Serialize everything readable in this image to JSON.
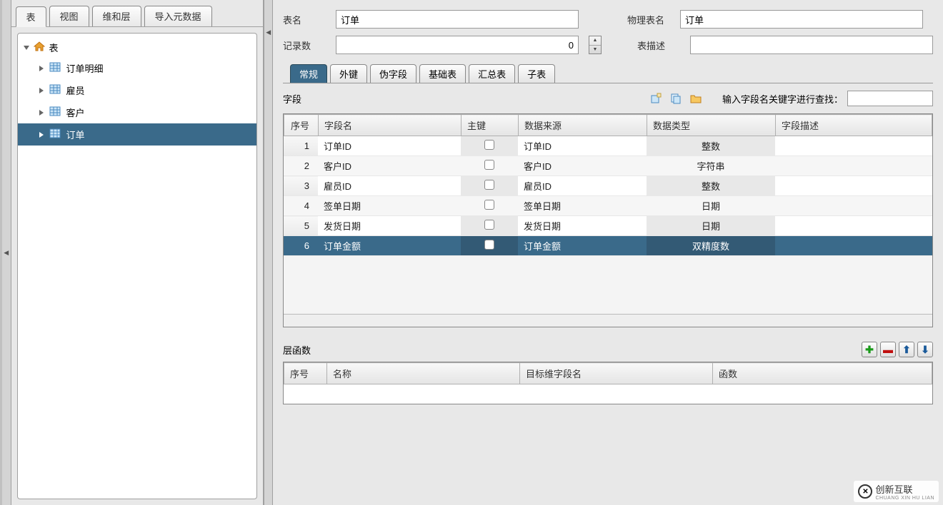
{
  "top_tabs": [
    "表",
    "视图",
    "维和层",
    "导入元数据"
  ],
  "active_top_tab": 0,
  "tree": {
    "root": "表",
    "items": [
      "订单明细",
      "雇员",
      "客户",
      "订单"
    ],
    "selected": 3
  },
  "form": {
    "table_name_label": "表名",
    "table_name_value": "订单",
    "phys_name_label": "物理表名",
    "phys_name_value": "订单",
    "record_count_label": "记录数",
    "record_count_value": "0",
    "desc_label": "表描述",
    "desc_value": ""
  },
  "sub_tabs": [
    "常规",
    "外键",
    "伪字段",
    "基础表",
    "汇总表",
    "子表"
  ],
  "active_sub_tab": 0,
  "field_section_label": "字段",
  "search_label": "输入字段名关键字进行查找：",
  "search_value": "",
  "field_cols": [
    "序号",
    "字段名",
    "主键",
    "数据来源",
    "数据类型",
    "字段描述"
  ],
  "field_rows": [
    {
      "seq": "1",
      "name": "订单ID",
      "pk": false,
      "source": "订单ID",
      "type": "整数",
      "desc": ""
    },
    {
      "seq": "2",
      "name": "客户ID",
      "pk": false,
      "source": "客户ID",
      "type": "字符串",
      "desc": ""
    },
    {
      "seq": "3",
      "name": "雇员ID",
      "pk": false,
      "source": "雇员ID",
      "type": "整数",
      "desc": ""
    },
    {
      "seq": "4",
      "name": "签单日期",
      "pk": false,
      "source": "签单日期",
      "type": "日期",
      "desc": ""
    },
    {
      "seq": "5",
      "name": "发货日期",
      "pk": false,
      "source": "发货日期",
      "type": "日期",
      "desc": ""
    },
    {
      "seq": "6",
      "name": "订单金额",
      "pk": false,
      "source": "订单金额",
      "type": "双精度数",
      "desc": ""
    }
  ],
  "selected_field_row": 5,
  "bottom": {
    "title": "层函数",
    "cols": [
      "序号",
      "名称",
      "目标维字段名",
      "函数"
    ]
  },
  "watermark": {
    "brand": "创新互联"
  }
}
